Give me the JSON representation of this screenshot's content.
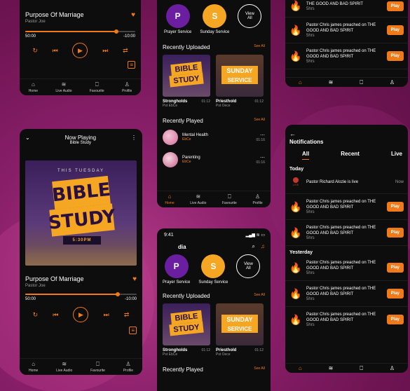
{
  "player_top": {
    "title": "Purpose Of Marriage",
    "artist": "Pastor Joe",
    "time_current": "50:00",
    "time_remaining": "-10:00",
    "progress": 0.83,
    "nav": [
      "Home",
      "Live Audio",
      "Favourite",
      "Profile"
    ]
  },
  "player_main": {
    "header_title": "Now Playing",
    "header_subtitle": "Bible Study",
    "art_top": "THIS TUESDAY",
    "art_line1": "BIBLE",
    "art_line2": "STUDY",
    "art_time": "5:30PM",
    "title": "Purpose Of Marriage",
    "artist": "Pastor Joe",
    "time_current": "50:00",
    "time_remaining": "-10:00",
    "progress": 0.83,
    "nav": [
      "Home",
      "Live Audio",
      "Favourite",
      "Profile"
    ]
  },
  "home_top": {
    "services": [
      {
        "letter": "P",
        "label": "Prayer Service"
      },
      {
        "letter": "S",
        "label": "Sunday Service"
      }
    ],
    "view_all": "View All",
    "recently_uploaded": "Recently Uploaded",
    "see_all": "See All",
    "uploads": [
      {
        "title": "Strongholds",
        "author": "Pst EbCe",
        "duration": "01:12",
        "art1": "BIBLE",
        "art2": "STUDY"
      },
      {
        "title": "Priesthold",
        "author": "Pst Oece",
        "duration": "01:12",
        "art1": "SUNDAY",
        "art2": "SERVICE"
      }
    ],
    "recently_played": "Recently Played",
    "see_all_2": "See All",
    "played": [
      {
        "title": "Mental Health",
        "author": "EbCe",
        "duration": "01:16"
      },
      {
        "title": "Parenting",
        "author": "EbCe",
        "duration": "01:16"
      }
    ],
    "nav": [
      "Home",
      "Live Audio",
      "Favourite",
      "Profile"
    ]
  },
  "home_bottom": {
    "time": "9:41",
    "greeting": "dia",
    "services": [
      {
        "letter": "P",
        "label": "Prayer Service"
      },
      {
        "letter": "S",
        "label": "Sunday Service"
      }
    ],
    "view_all": "View All",
    "recently_uploaded": "Recently Uploaded",
    "see_all": "See All",
    "uploads": [
      {
        "title": "Strongholds",
        "author": "Pst EbCe",
        "duration": "01:12",
        "art1": "BIBLE",
        "art2": "STUDY"
      },
      {
        "title": "Priesthold",
        "author": "Pst Oece",
        "duration": "01:12",
        "art1": "SUNDAY",
        "art2": "SERVICE"
      }
    ],
    "recently_played": "Recently Played",
    "see_all_2": "See All"
  },
  "notif_top": {
    "items": [
      {
        "text": "THE GOOD AND BAD SPIRIT",
        "time": "5hrs",
        "action": "Play"
      },
      {
        "text": "Pastor Chris james preached on THE GOOD AND BAD SPIRIT",
        "time": "5hrs",
        "action": "Play"
      },
      {
        "text": "Pastor Chris james preached on THE GOOD AND BAD SPIRIT",
        "time": "5hrs",
        "action": "Play"
      }
    ]
  },
  "notif_main": {
    "title": "Notifications",
    "tabs": [
      "All",
      "Recent",
      "Live"
    ],
    "today": "Today",
    "live_item": {
      "text": "Pastor Richard Alozie is live",
      "time": "Now",
      "badge": "LIVE"
    },
    "today_items": [
      {
        "text": "Pastor Chris james preached on THE GOOD AND BAD SPIRIT",
        "time": "5hrs",
        "action": "Play"
      },
      {
        "text": "Pastor Chris james preached on THE GOOD AND BAD SPIRIT",
        "time": "5hrs",
        "action": "Play"
      }
    ],
    "yesterday": "Yesterday",
    "yesterday_items": [
      {
        "text": "Pastor Chris james preached on THE GOOD AND BAD SPIRIT",
        "time": "5hrs",
        "action": "Play"
      },
      {
        "text": "Pastor Chris james preached on THE GOOD AND BAD SPIRIT",
        "time": "5hrs",
        "action": "Play"
      },
      {
        "text": "Pastor Chris james preached on THE GOOD AND BAD SPIRIT",
        "time": "5hrs",
        "action": "Play"
      }
    ]
  },
  "colors": {
    "accent": "#f07a1a",
    "purple": "#6b1fa0",
    "yellow": "#f5a623",
    "bg": "#0d0d0d"
  }
}
